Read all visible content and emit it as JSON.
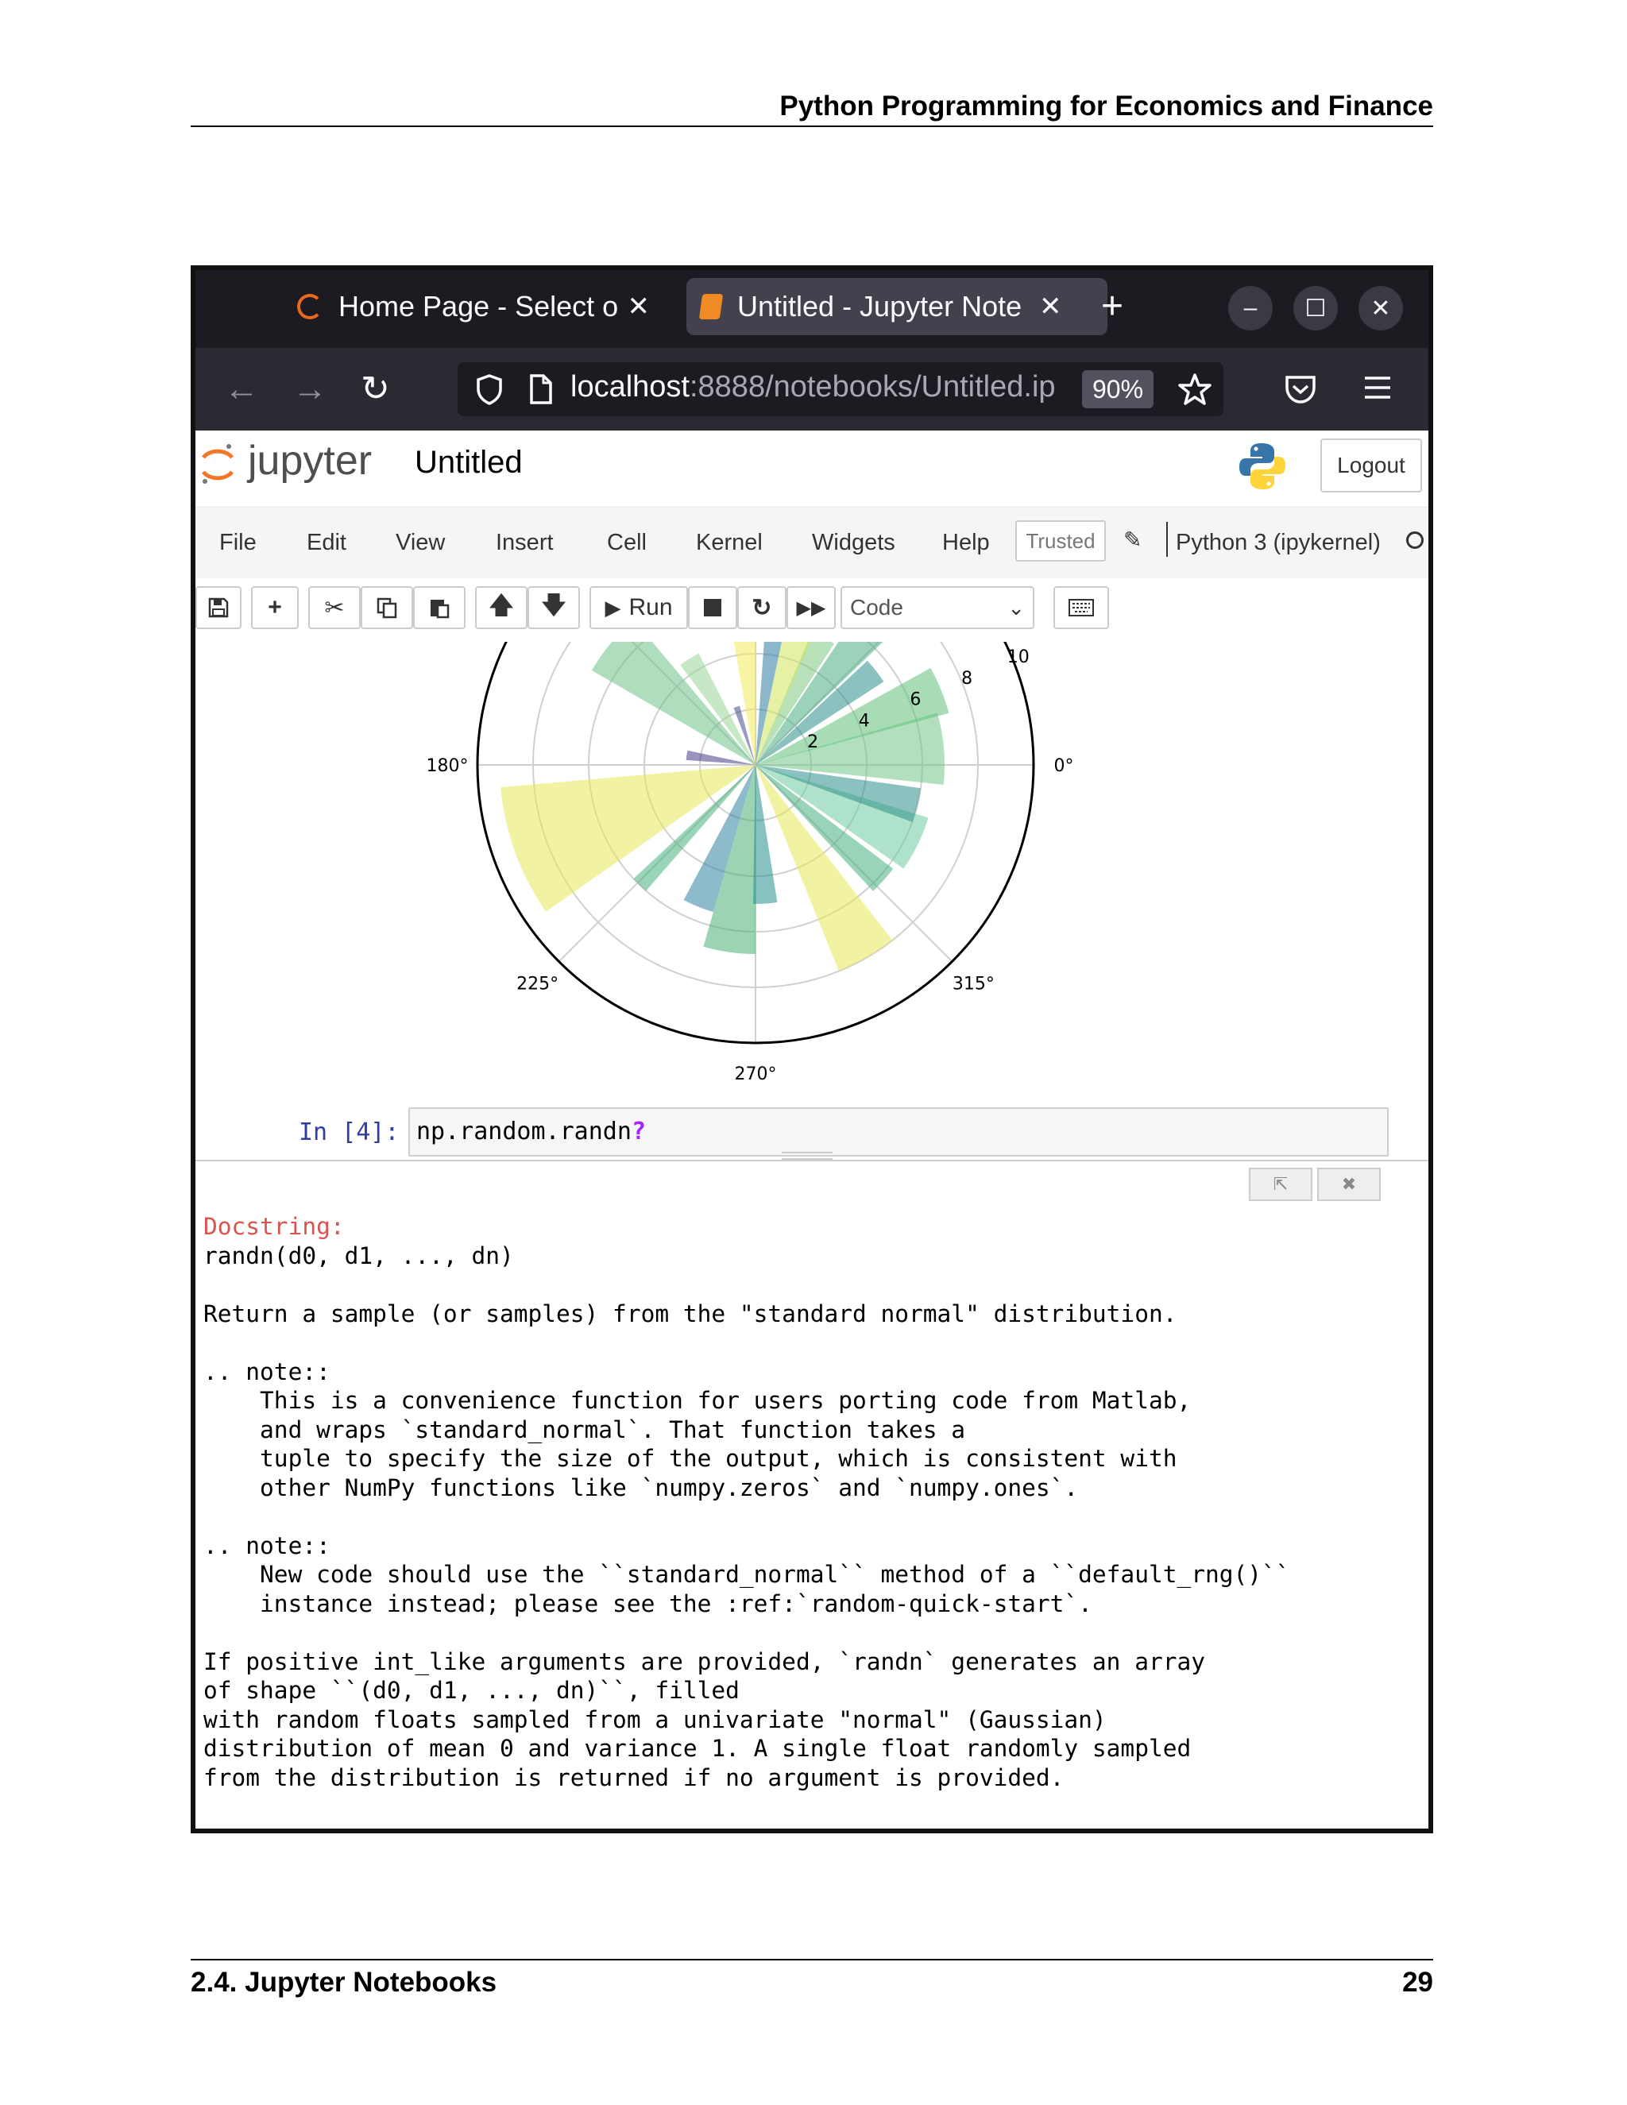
{
  "page": {
    "header_title": "Python Programming for Economics and Finance",
    "footer_section": "2.4.  Jupyter Notebooks",
    "footer_page": "29"
  },
  "browser": {
    "tabs": [
      {
        "label": "Home Page - Select or c",
        "close": "✕"
      },
      {
        "label": "Untitled - Jupyter Note",
        "close": "✕"
      }
    ],
    "new_tab": "+",
    "window_buttons": {
      "minimize": "–",
      "maximize": "☐",
      "close": "✕"
    },
    "nav": {
      "back": "←",
      "forward": "→",
      "reload": "↻"
    },
    "url_host": "localhost",
    "url_path": ":8888/notebooks/Untitled.ip",
    "zoom": "90%"
  },
  "jupyter": {
    "logo_text": "jupyter",
    "notebook_title": "Untitled",
    "logout_label": "Logout",
    "menu": [
      "File",
      "Edit",
      "View",
      "Insert",
      "Cell",
      "Kernel",
      "Widgets",
      "Help"
    ],
    "trusted_label": "Trusted",
    "kernel_name": "Python 3 (ipykernel)",
    "toolbar": {
      "run_label": "Run",
      "cell_type": "Code"
    }
  },
  "cell": {
    "prompt": "In [4]:",
    "code": "np.random.randn",
    "code_suffix": "?"
  },
  "pager": {
    "header": "Docstring:",
    "body": "randn(d0, d1, ..., dn)\n\nReturn a sample (or samples) from the \"standard normal\" distribution.\n\n.. note::\n    This is a convenience function for users porting code from Matlab,\n    and wraps `standard_normal`. That function takes a\n    tuple to specify the size of the output, which is consistent with\n    other NumPy functions like `numpy.zeros` and `numpy.ones`.\n\n.. note::\n    New code should use the ``standard_normal`` method of a ``default_rng()``\n    instance instead; please see the :ref:`random-quick-start`.\n\nIf positive int_like arguments are provided, `randn` generates an array\nof shape ``(d0, d1, ..., dn)``, filled\nwith random floats sampled from a univariate \"normal\" (Gaussian)\ndistribution of mean 0 and variance 1. A single float randomly sampled\nfrom the distribution is returned if no argument is provided."
  },
  "chart_data": {
    "type": "polar-bar",
    "title": "",
    "angle_tick_labels": [
      "0°",
      "180°",
      "225°",
      "270°",
      "315°"
    ],
    "radial_tick_labels": [
      "2",
      "4",
      "6",
      "8",
      "10"
    ],
    "rmax": 10,
    "bars": [
      {
        "theta": 5,
        "width": 22,
        "r": 6.8,
        "color": "#73c587"
      },
      {
        "theta": 22,
        "width": 14,
        "r": 7.2,
        "color": "#5ebf79"
      },
      {
        "theta": 38,
        "width": 10,
        "r": 5.5,
        "color": "#2b8f8c"
      },
      {
        "theta": 50,
        "width": 12,
        "r": 8.5,
        "color": "#4aab82"
      },
      {
        "theta": 62,
        "width": 10,
        "r": 5.2,
        "color": "#7fc97f"
      },
      {
        "theta": 72,
        "width": 12,
        "r": 9.5,
        "color": "#d1e55d"
      },
      {
        "theta": 82,
        "width": 8,
        "r": 5.5,
        "color": "#2c7aa0"
      },
      {
        "theta": 95,
        "width": 10,
        "r": 9.8,
        "color": "#f2ee5a"
      },
      {
        "theta": 108,
        "width": 6,
        "r": 2.2,
        "color": "#444c8c"
      },
      {
        "theta": 122,
        "width": 10,
        "r": 4.5,
        "color": "#99d595"
      },
      {
        "theta": 140,
        "width": 20,
        "r": 6.8,
        "color": "#6cc389"
      },
      {
        "theta": 172,
        "width": 8,
        "r": 2.5,
        "color": "#453c87"
      },
      {
        "theta": 200,
        "width": 30,
        "r": 9.2,
        "color": "#e6ea55"
      },
      {
        "theta": 226,
        "width": 6,
        "r": 6.0,
        "color": "#45b27a"
      },
      {
        "theta": 248,
        "width": 12,
        "r": 5.5,
        "color": "#2f84a0"
      },
      {
        "theta": 262,
        "width": 16,
        "r": 6.8,
        "color": "#4bb075"
      },
      {
        "theta": 274,
        "width": 10,
        "r": 5.0,
        "color": "#248f8e"
      },
      {
        "theta": 300,
        "width": 16,
        "r": 8.0,
        "color": "#e7ea56"
      },
      {
        "theta": 318,
        "width": 10,
        "r": 6.2,
        "color": "#46b07d"
      },
      {
        "theta": 334,
        "width": 18,
        "r": 6.5,
        "color": "#6ecaa0"
      },
      {
        "theta": 346,
        "width": 12,
        "r": 6.0,
        "color": "#2c8f8a"
      }
    ]
  }
}
